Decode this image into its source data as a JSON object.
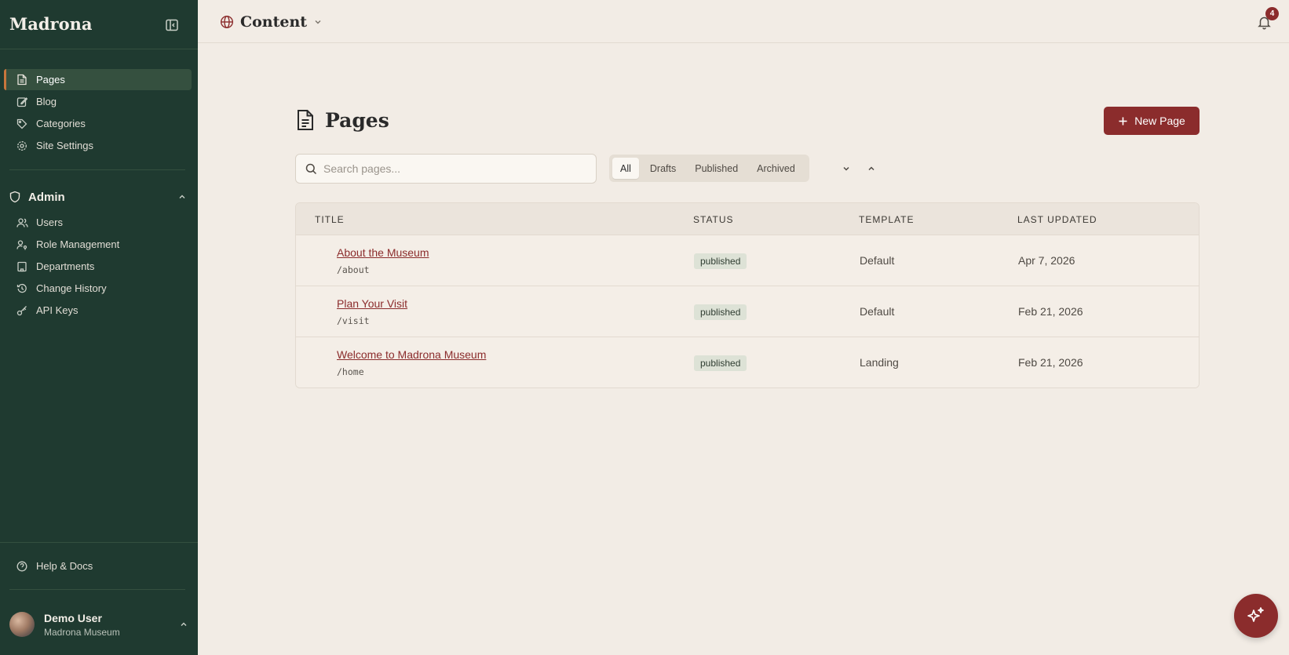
{
  "sidebar": {
    "brand": "Madrona",
    "items": [
      {
        "label": "Pages",
        "icon": "file-icon"
      },
      {
        "label": "Blog",
        "icon": "edit-icon"
      },
      {
        "label": "Categories",
        "icon": "tag-icon"
      },
      {
        "label": "Site Settings",
        "icon": "gear-icon"
      }
    ],
    "admin": {
      "title": "Admin",
      "items": [
        {
          "label": "Users",
          "icon": "users-icon"
        },
        {
          "label": "Role Management",
          "icon": "user-key-icon"
        },
        {
          "label": "Departments",
          "icon": "building-icon"
        },
        {
          "label": "Change History",
          "icon": "history-icon"
        },
        {
          "label": "API Keys",
          "icon": "key-icon"
        }
      ]
    },
    "help": "Help & Docs",
    "user": {
      "name": "Demo User",
      "org": "Madrona Museum"
    }
  },
  "topbar": {
    "workspace": "Content",
    "notifications": "4"
  },
  "main": {
    "title": "Pages",
    "new_button": "New Page",
    "search_placeholder": "Search pages...",
    "filters": [
      "All",
      "Drafts",
      "Published",
      "Archived"
    ],
    "active_filter": "All",
    "table": {
      "headers": [
        "TITLE",
        "STATUS",
        "TEMPLATE",
        "LAST UPDATED"
      ],
      "rows": [
        {
          "title": "About the Museum",
          "slug": "/about",
          "status": "published",
          "template": "Default",
          "updated": "Apr 7, 2026"
        },
        {
          "title": "Plan Your Visit",
          "slug": "/visit",
          "status": "published",
          "template": "Default",
          "updated": "Feb 21, 2026"
        },
        {
          "title": "Welcome to Madrona Museum",
          "slug": "/home",
          "status": "published",
          "template": "Landing",
          "updated": "Feb 21, 2026"
        }
      ]
    }
  },
  "colors": {
    "sidebar_bg": "#1f3a30",
    "accent": "#8b2c2c",
    "active_marker": "#c8763c",
    "page_bg": "#f2ece5"
  }
}
